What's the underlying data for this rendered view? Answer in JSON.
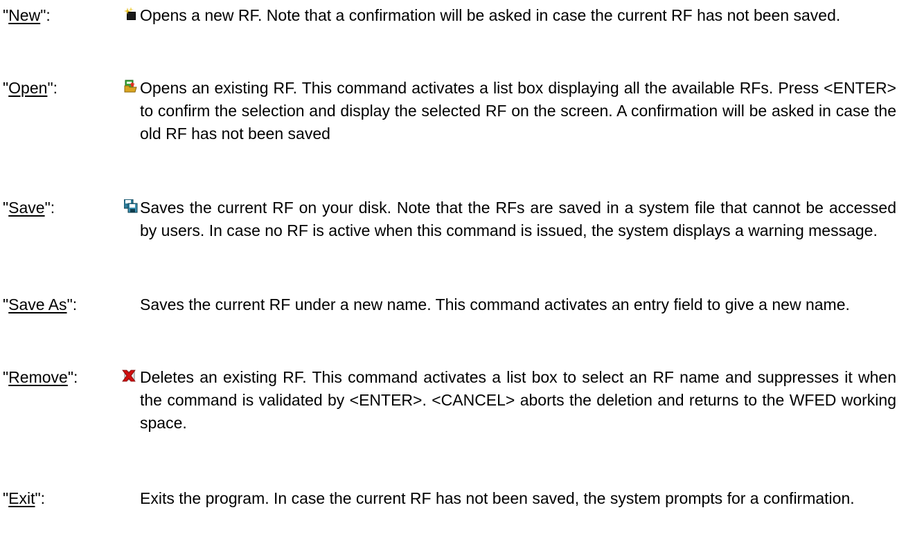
{
  "entries": [
    {
      "id": "new",
      "quote_open": "\"",
      "term": "New",
      "quote_close": "\":",
      "icon": "new-document-sparkle-icon",
      "description": "Opens a new RF. Note that a confirmation will be asked in case the current RF has not been saved."
    },
    {
      "id": "open",
      "quote_open": "\"",
      "term": "Open",
      "quote_close": "\":",
      "icon": "open-folder-icon",
      "description": "Opens an existing RF. This command activates a list box displaying all the available RFs. Press <ENTER> to confirm the selection and display the selected RF on the screen. A confirmation will be asked in case the old RF has not been saved"
    },
    {
      "id": "save",
      "quote_open": "\"",
      "term": "Save",
      "quote_close": "\":",
      "icon": "floppy-disk-save-icon",
      "description": "Saves the current RF on your disk. Note that the RFs are saved in a system file that cannot be accessed by users. In case no RF is active when this command is issued, the system displays a warning message."
    },
    {
      "id": "save-as",
      "quote_open": "\"",
      "term": "Save As",
      "quote_close": "\":",
      "icon": "",
      "description": "Saves the current RF under a new name. This command activates an entry field to give a new name."
    },
    {
      "id": "remove",
      "quote_open": "\"",
      "term": "Remove",
      "quote_close": "\":",
      "icon": "delete-red-x-icon",
      "description": "Deletes an existing RF. This command activates a list box to select an RF name and suppresses it when the command is validated by <ENTER>. <CANCEL> aborts the deletion and returns to the WFED working space."
    },
    {
      "id": "exit",
      "quote_open": "\"",
      "term": "Exit",
      "quote_close": "\":",
      "icon": "",
      "description": "Exits the program. In case the current RF has not been saved, the system prompts for a confirmation."
    }
  ],
  "colors": {
    "text": "#000000",
    "background": "#ffffff",
    "remove_icon_red": "#d01010",
    "open_icon_green": "#2e9a2e",
    "open_icon_folder": "#d9a520"
  }
}
